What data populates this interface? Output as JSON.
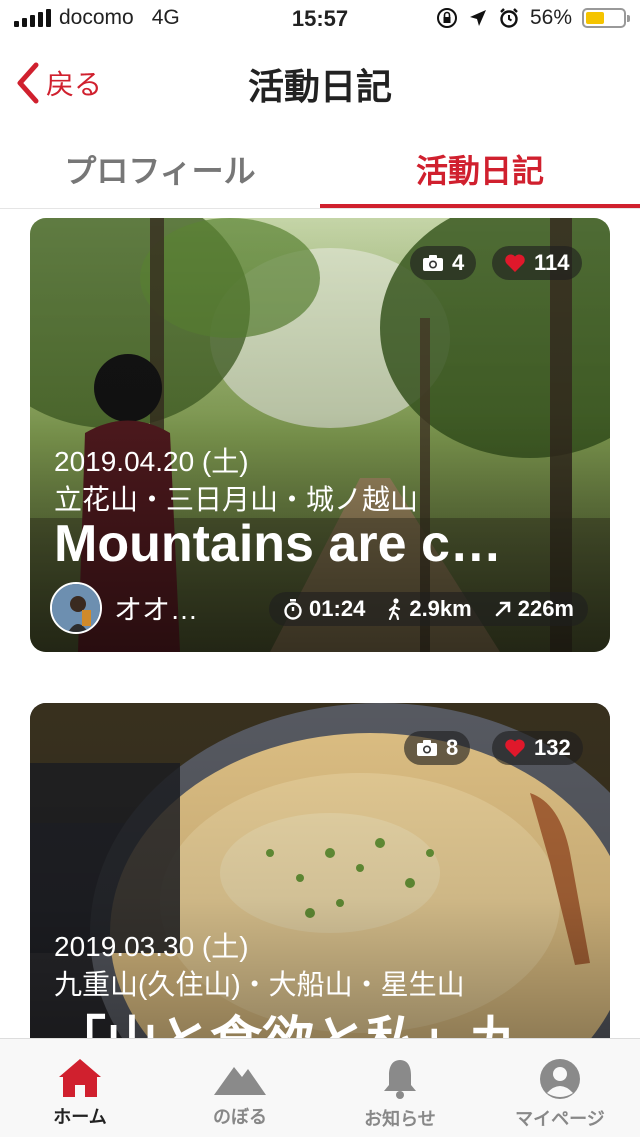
{
  "status_bar": {
    "carrier": "docomo",
    "network": "4G",
    "time": "15:57",
    "battery": "56%",
    "battery_level": 0.56
  },
  "nav": {
    "back_label": "戻る",
    "title": "活動日記"
  },
  "tabs": [
    {
      "label": "プロフィール",
      "active": false
    },
    {
      "label": "活動日記",
      "active": true
    }
  ],
  "cards": [
    {
      "photos": "4",
      "likes": "114",
      "date": "2019.04.20 (土)",
      "place": "立花山・三日月山・城ノ越山",
      "title": "Mountains are c…",
      "user": "オオ…",
      "time": "01:24",
      "distance": "2.9km",
      "elevation": "226m"
    },
    {
      "photos": "8",
      "likes": "132",
      "date": "2019.03.30 (土)",
      "place": "九重山(久住山)・大船山・星生山",
      "title": "「山と食欲と私」九…"
    }
  ],
  "tab_bar": [
    {
      "label": "ホーム",
      "icon": "home-icon",
      "active": true
    },
    {
      "label": "のぼる",
      "icon": "mountain-icon",
      "active": false
    },
    {
      "label": "お知らせ",
      "icon": "bell-icon",
      "active": false
    },
    {
      "label": "マイページ",
      "icon": "person-icon",
      "active": false
    }
  ],
  "colors": {
    "accent": "#d0202e",
    "battery": "#f5c400"
  }
}
